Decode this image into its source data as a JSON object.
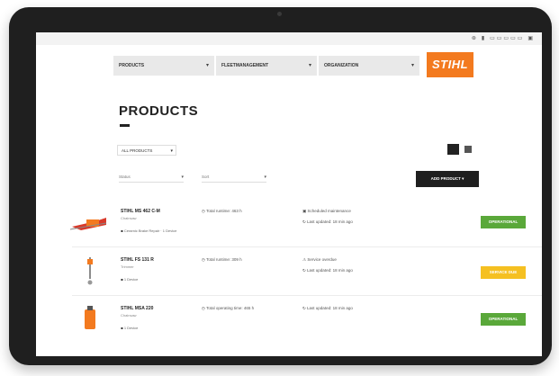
{
  "colors": {
    "brand": "#f37a1f",
    "status_green": "#5aa83a",
    "status_yellow": "#f5c021",
    "dark": "#1f1f1f"
  },
  "sysbar": {
    "icons": "⊛ ▮ ▭▭▭▭▭ ▣"
  },
  "nav": {
    "items": [
      {
        "label": "PRODUCTS",
        "icon": "chevron-down-icon"
      },
      {
        "label": "FLEETMANAGEMENT",
        "icon": "chevron-down-icon"
      },
      {
        "label": "ORGANIZATION",
        "icon": "chevron-down-icon"
      }
    ],
    "brand": "STIHL"
  },
  "page": {
    "title": "PRODUCTS"
  },
  "filters": {
    "all": "ALL PRODUCTS",
    "status_placeholder": "Status",
    "sort_placeholder": "Sort",
    "add_product": "ADD PRODUCT"
  },
  "products": [
    {
      "name": "STIHL MS 462 C-M",
      "sub": "Chainsaw",
      "meta": "Ceramic Brake Repair · 1 Device",
      "col1": "Total runtime: 463 h",
      "col2a": "Scheduled maintenance",
      "col2b": "Last updated: 18 min ago",
      "status": "OPERATIONAL",
      "status_color": "green"
    },
    {
      "name": "STIHL FS 131 R",
      "sub": "Trimmer",
      "meta": "1 Device",
      "col1": "Total runtime: 309 h",
      "col2a": "Service overdue",
      "col2b": "Last updated: 18 min ago",
      "status": "SERVICE DUE",
      "status_color": "yellow"
    },
    {
      "name": "STIHL MSA 220",
      "sub": "Chainsaw",
      "meta": "1 Device",
      "col1": "Total operating time: 465 h",
      "col2a": "Last updated: 18 min ago",
      "col2b": "",
      "status": "OPERATIONAL",
      "status_color": "green"
    }
  ]
}
